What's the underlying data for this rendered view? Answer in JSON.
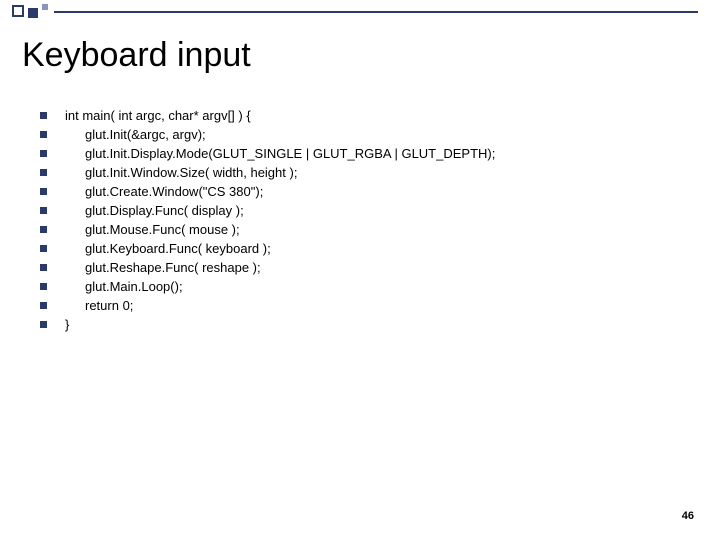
{
  "title": "Keyboard input",
  "code_lines": [
    {
      "text": "int main( int argc, char* argv[] ) {",
      "indent": false
    },
    {
      "text": "glut.Init(&argc, argv);",
      "indent": true
    },
    {
      "text": "glut.Init.Display.Mode(GLUT_SINGLE | GLUT_RGBA | GLUT_DEPTH);",
      "indent": true
    },
    {
      "text": "glut.Init.Window.Size( width, height );",
      "indent": true
    },
    {
      "text": "glut.Create.Window(\"CS 380\");",
      "indent": true
    },
    {
      "text": "glut.Display.Func( display );",
      "indent": true
    },
    {
      "text": "glut.Mouse.Func( mouse );",
      "indent": true
    },
    {
      "text": "glut.Keyboard.Func( keyboard );",
      "indent": true
    },
    {
      "text": "glut.Reshape.Func( reshape );",
      "indent": true
    },
    {
      "text": "glut.Main.Loop();",
      "indent": true
    },
    {
      "text": "return 0;",
      "indent": true
    },
    {
      "text": "}",
      "indent": false
    }
  ],
  "page_number": "46"
}
